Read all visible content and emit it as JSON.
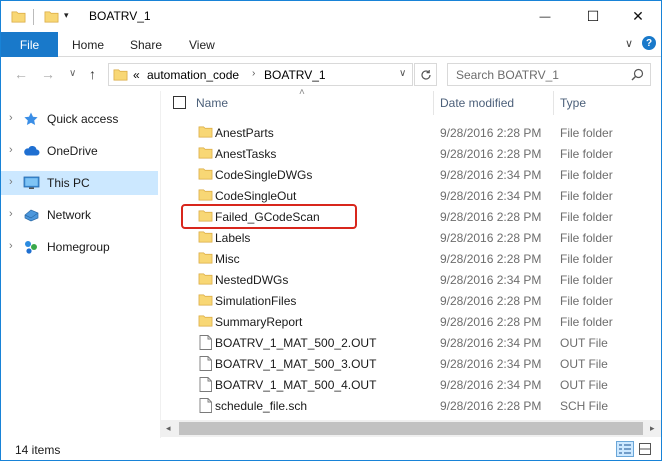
{
  "window": {
    "title": "BOATRV_1",
    "dropdown_glyph": "▾",
    "minimize_glyph": "—",
    "maximize_glyph": "☐",
    "close_glyph": "✕"
  },
  "ribbon": {
    "tabs": [
      "File",
      "Home",
      "Share",
      "View"
    ],
    "accent_color": "#1979ca",
    "expand_glyph": "∨",
    "help_glyph": "?"
  },
  "address_bar": {
    "back_glyph": "←",
    "forward_glyph": "→",
    "recent_glyph": "∨",
    "up_glyph": "↑",
    "overflow": "«",
    "breadcrumbs": [
      "automation_code",
      "BOATRV_1"
    ],
    "separator_glyph": "›",
    "dropdown_glyph": "∨",
    "search_placeholder": "Search BOATRV_1"
  },
  "sidebar": {
    "expand_glyph": "›",
    "items": [
      {
        "label": "Quick access",
        "icon": "star-icon",
        "selected": false
      },
      {
        "label": "OneDrive",
        "icon": "cloud-icon",
        "selected": false
      },
      {
        "label": "This PC",
        "icon": "computer-icon",
        "selected": true
      },
      {
        "label": "Network",
        "icon": "network-icon",
        "selected": false
      },
      {
        "label": "Homegroup",
        "icon": "homegroup-icon",
        "selected": false
      }
    ]
  },
  "columns": {
    "name": "Name",
    "date": "Date modified",
    "type": "Type",
    "sort_glyph": "˄"
  },
  "files": [
    {
      "name": "AnestParts",
      "date": "9/28/2016 2:28 PM",
      "type": "File folder",
      "kind": "folder"
    },
    {
      "name": "AnestTasks",
      "date": "9/28/2016 2:28 PM",
      "type": "File folder",
      "kind": "folder"
    },
    {
      "name": "CodeSingleDWGs",
      "date": "9/28/2016 2:34 PM",
      "type": "File folder",
      "kind": "folder"
    },
    {
      "name": "CodeSingleOut",
      "date": "9/28/2016 2:34 PM",
      "type": "File folder",
      "kind": "folder"
    },
    {
      "name": "Failed_GCodeScan",
      "date": "9/28/2016 2:28 PM",
      "type": "File folder",
      "kind": "folder",
      "highlighted": true
    },
    {
      "name": "Labels",
      "date": "9/28/2016 2:28 PM",
      "type": "File folder",
      "kind": "folder"
    },
    {
      "name": "Misc",
      "date": "9/28/2016 2:28 PM",
      "type": "File folder",
      "kind": "folder"
    },
    {
      "name": "NestedDWGs",
      "date": "9/28/2016 2:34 PM",
      "type": "File folder",
      "kind": "folder"
    },
    {
      "name": "SimulationFiles",
      "date": "9/28/2016 2:28 PM",
      "type": "File folder",
      "kind": "folder"
    },
    {
      "name": "SummaryReport",
      "date": "9/28/2016 2:28 PM",
      "type": "File folder",
      "kind": "folder"
    },
    {
      "name": "BOATRV_1_MAT_500_2.OUT",
      "date": "9/28/2016 2:34 PM",
      "type": "OUT File",
      "kind": "file"
    },
    {
      "name": "BOATRV_1_MAT_500_3.OUT",
      "date": "9/28/2016 2:34 PM",
      "type": "OUT File",
      "kind": "file"
    },
    {
      "name": "BOATRV_1_MAT_500_4.OUT",
      "date": "9/28/2016 2:34 PM",
      "type": "OUT File",
      "kind": "file"
    },
    {
      "name": "schedule_file.sch",
      "date": "9/28/2016 2:28 PM",
      "type": "SCH File",
      "kind": "file"
    }
  ],
  "scrollbar": {
    "left_glyph": "◂",
    "right_glyph": "▸"
  },
  "status": {
    "item_count": "14 items"
  },
  "colors": {
    "highlight_border": "#d8261c",
    "folder": "#f8d775",
    "selection": "#cce8ff",
    "window_border": "#1883d7"
  }
}
